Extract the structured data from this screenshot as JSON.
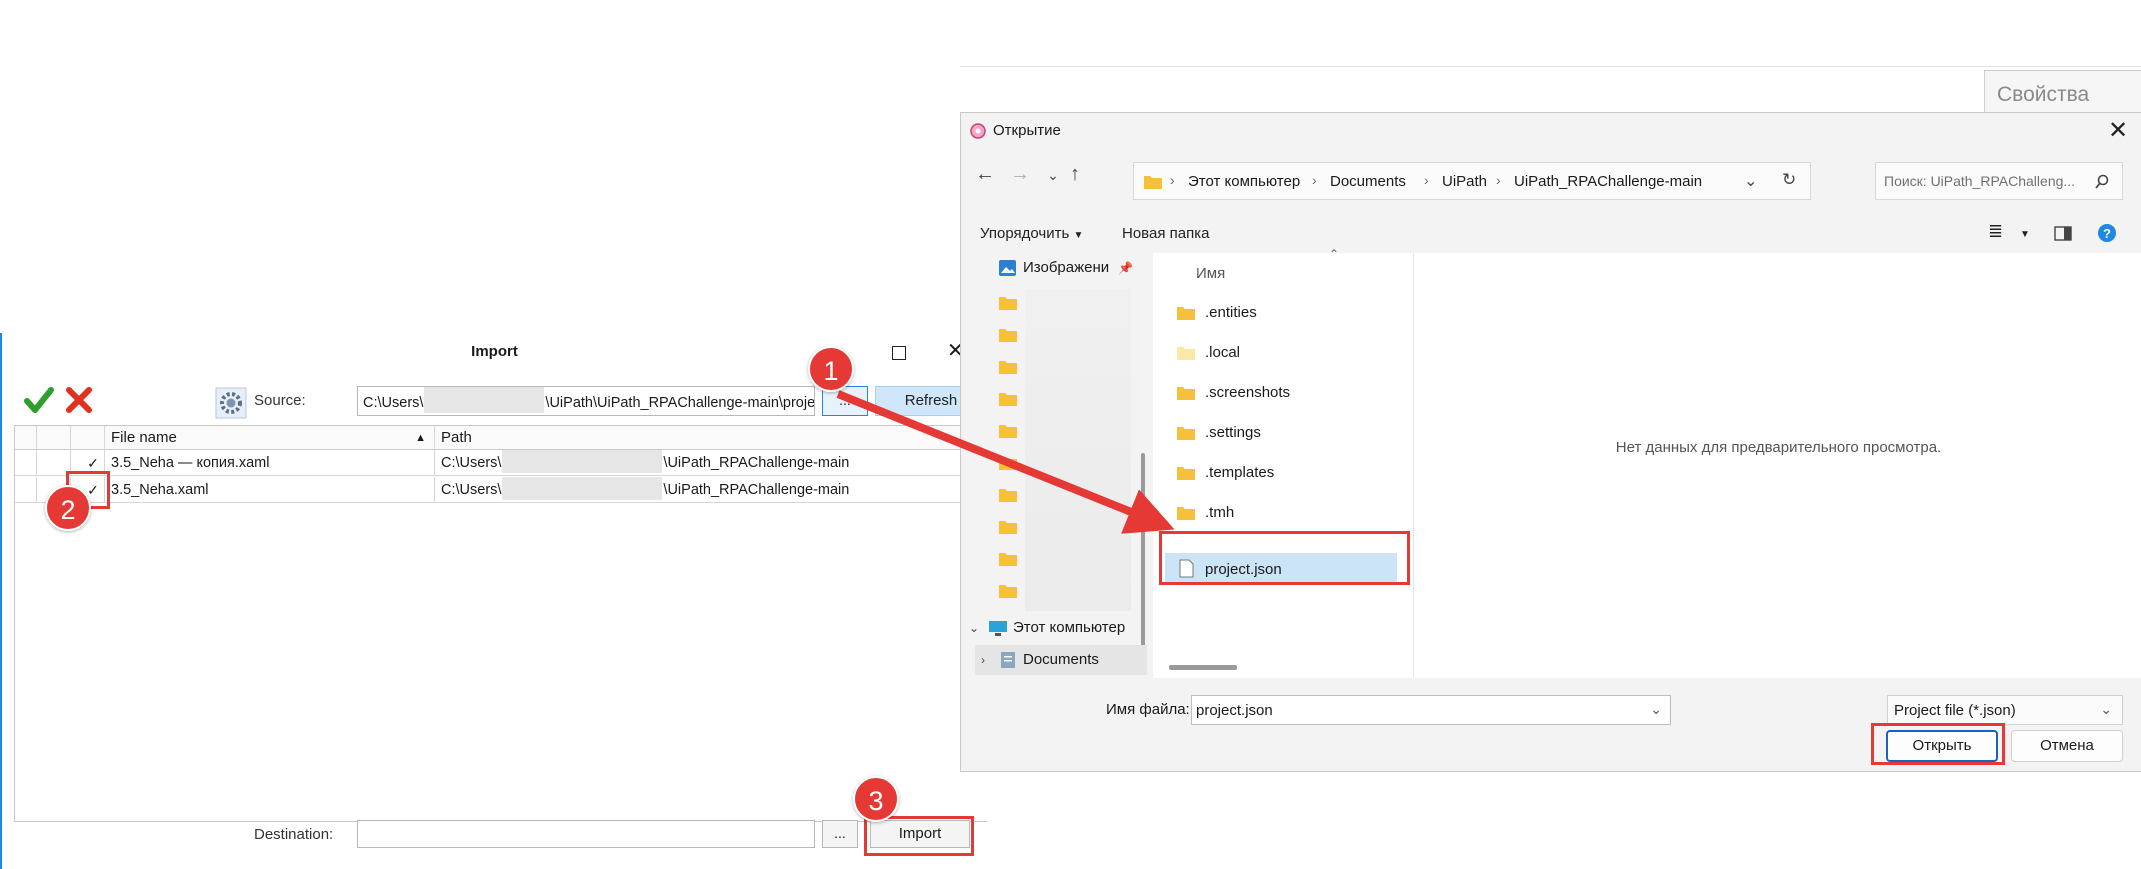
{
  "background_app": {
    "properties_tab": "Свойства"
  },
  "import_dialog": {
    "title": "Import",
    "source_label": "Source:",
    "source_prefix": "C:\\Users\\",
    "source_suffix": "\\UiPath\\UiPath_RPAChallenge-main\\proje",
    "browse_button": "...",
    "refresh_button": "Refresh",
    "columns": {
      "file_name": "File name",
      "path": "Path"
    },
    "rows": [
      {
        "checked": "✓",
        "file_name": "3.5_Neha — копия.xaml",
        "path_prefix": "C:\\Users\\",
        "path_suffix": "\\UiPath_RPAChallenge-main"
      },
      {
        "checked": "✓",
        "file_name": "3.5_Neha.xaml",
        "path_prefix": "C:\\Users\\",
        "path_suffix": "\\UiPath_RPAChallenge-main"
      }
    ],
    "destination_label": "Destination:",
    "destination_browse": "...",
    "import_button": "Import"
  },
  "open_dialog": {
    "title": "Открытие",
    "breadcrumbs": [
      "Этот компьютер",
      "Documents",
      "UiPath",
      "UiPath_RPAChallenge-main"
    ],
    "search_placeholder": "Поиск: UiPath_RPAChalleng...",
    "organize_button": "Упорядочить",
    "new_folder_button": "Новая папка",
    "nav_pane": {
      "pictures": "Изображени",
      "this_pc": "Этот компьютер",
      "documents": "Documents"
    },
    "column_name": "Имя",
    "files": [
      ".entities",
      ".local",
      ".screenshots",
      ".settings",
      ".templates",
      ".tmh",
      "project.json"
    ],
    "preview_message": "Нет данных для предварительного просмотра.",
    "file_name_label": "Имя файла:",
    "file_name_value": "project.json",
    "file_type_value": "Project file (*.json)",
    "open_button": "Открыть",
    "cancel_button": "Отмена"
  },
  "annotations": {
    "step1": "1",
    "step2": "2",
    "step3": "3"
  },
  "colors": {
    "accent": "#1e88e5",
    "highlight": "#e53935",
    "selection": "#cce4f7",
    "folder": "#f5c03c"
  }
}
